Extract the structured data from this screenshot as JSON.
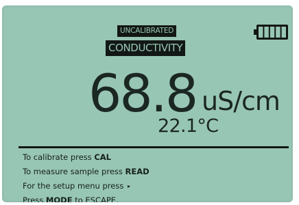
{
  "status": {
    "calibration": "UNCALIBRATED",
    "mode": "CONDUCTIVITY"
  },
  "battery": {
    "icon": "battery-icon",
    "bars": 5,
    "level_fraction": 1.0
  },
  "reading": {
    "value": "68.8",
    "unit": "uS/cm"
  },
  "temperature": {
    "value": "22.1°C"
  },
  "instructions": [
    {
      "prefix": "To calibrate press ",
      "key": "CAL",
      "suffix": ""
    },
    {
      "prefix": "To measure sample press ",
      "key": "READ",
      "suffix": ""
    },
    {
      "prefix": "For the setup menu press ",
      "key": "",
      "suffix": "▸"
    },
    {
      "prefix": "Press ",
      "key": "MODE",
      "suffix": " to ESCAPE."
    }
  ],
  "colors": {
    "lcd_background": "#98c6b4",
    "lcd_foreground": "#14201c"
  }
}
